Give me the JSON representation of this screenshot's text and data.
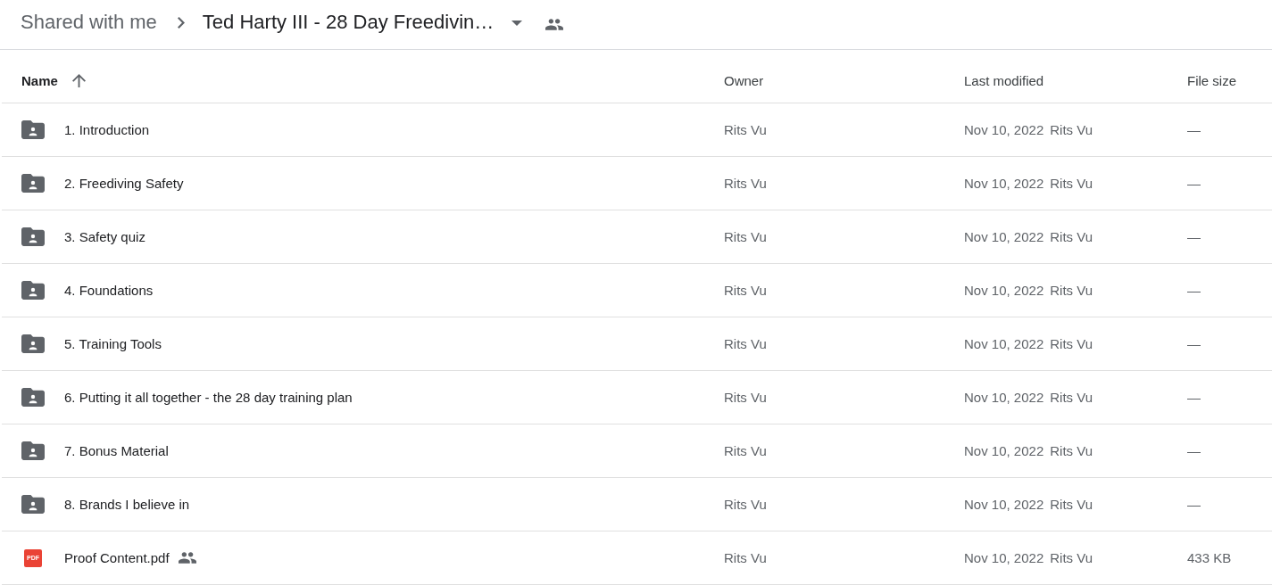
{
  "breadcrumb": {
    "items": [
      {
        "label": "Shared with me",
        "kind": "link",
        "has_menu": false,
        "shared": false
      },
      {
        "label": "Ted Harty III - 28 Day Freedivin…",
        "kind": "folder",
        "has_menu": true,
        "shared": true
      }
    ]
  },
  "table": {
    "columns": [
      {
        "label": "Name",
        "sorted": true
      },
      {
        "label": "Owner",
        "sorted": false
      },
      {
        "label": "Last modified",
        "sorted": false
      },
      {
        "label": "File size",
        "sorted": false
      }
    ],
    "rows": [
      {
        "kind": "shared-folder",
        "name": "1. Introduction",
        "shared": false,
        "owner": "Rits Vu",
        "modified_date": "Nov 10, 2022",
        "modified_by": "Rits Vu",
        "size": "—"
      },
      {
        "kind": "shared-folder",
        "name": "2. Freediving Safety",
        "shared": false,
        "owner": "Rits Vu",
        "modified_date": "Nov 10, 2022",
        "modified_by": "Rits Vu",
        "size": "—"
      },
      {
        "kind": "shared-folder",
        "name": "3. Safety quiz",
        "shared": false,
        "owner": "Rits Vu",
        "modified_date": "Nov 10, 2022",
        "modified_by": "Rits Vu",
        "size": "—"
      },
      {
        "kind": "shared-folder",
        "name": "4. Foundations",
        "shared": false,
        "owner": "Rits Vu",
        "modified_date": "Nov 10, 2022",
        "modified_by": "Rits Vu",
        "size": "—"
      },
      {
        "kind": "shared-folder",
        "name": "5. Training Tools",
        "shared": false,
        "owner": "Rits Vu",
        "modified_date": "Nov 10, 2022",
        "modified_by": "Rits Vu",
        "size": "—"
      },
      {
        "kind": "shared-folder",
        "name": "6. Putting it all together - the 28 day training plan",
        "shared": false,
        "owner": "Rits Vu",
        "modified_date": "Nov 10, 2022",
        "modified_by": "Rits Vu",
        "size": "—"
      },
      {
        "kind": "shared-folder",
        "name": "7. Bonus Material",
        "shared": false,
        "owner": "Rits Vu",
        "modified_date": "Nov 10, 2022",
        "modified_by": "Rits Vu",
        "size": "—"
      },
      {
        "kind": "shared-folder",
        "name": "8. Brands I believe in",
        "shared": false,
        "owner": "Rits Vu",
        "modified_date": "Nov 10, 2022",
        "modified_by": "Rits Vu",
        "size": "—"
      },
      {
        "kind": "pdf",
        "type_label": "PDF",
        "name": "Proof Content.pdf",
        "shared": true,
        "owner": "Rits Vu",
        "modified_date": "Nov 10, 2022",
        "modified_by": "Rits Vu",
        "size": "433 KB"
      }
    ]
  }
}
